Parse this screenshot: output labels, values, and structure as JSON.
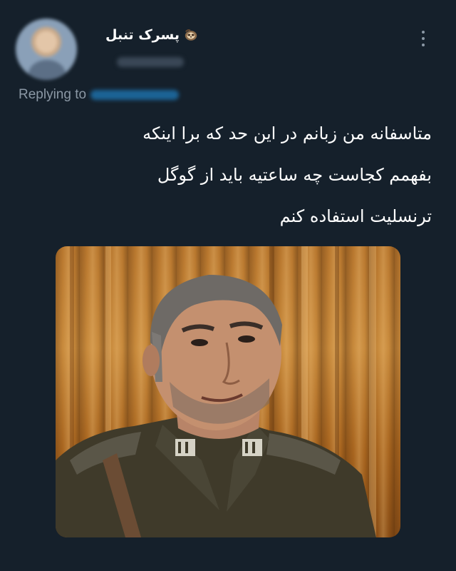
{
  "tweet": {
    "display_name": "پسرک تنبل",
    "name_emoji": "sloth-icon",
    "more_icon": "more-vertical-icon",
    "replying_label": "Replying to",
    "text_lines": [
      "متاسفانه من زبانم در این حد که برا اینکه",
      "بفهمم کجاست چه ساعتیه باید از گوگل",
      "ترنسلیت استفاده کنم"
    ],
    "media": {
      "description_icon": "photo-man-in-uniform"
    }
  },
  "colors": {
    "background": "#15202b",
    "secondary_text": "#8b98a5",
    "link": "#1d9bf0",
    "primary_text": "#ffffff"
  }
}
